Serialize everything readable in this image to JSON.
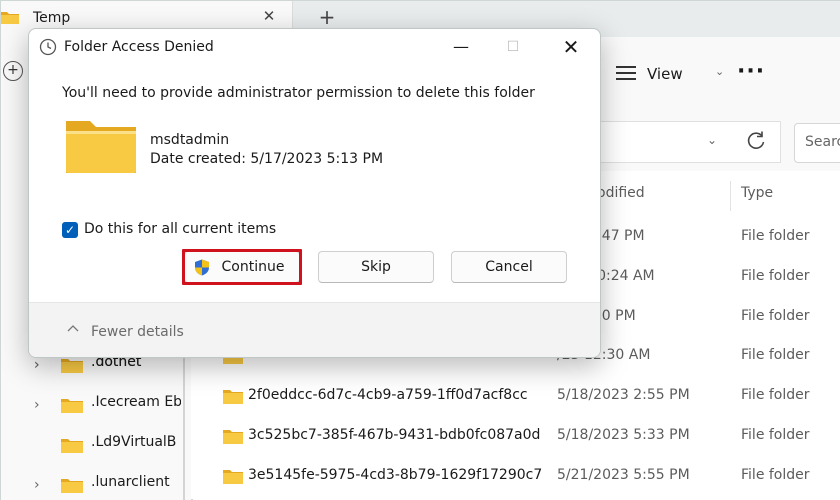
{
  "tab": {
    "title": "Temp",
    "close_glyph": "✕",
    "new_tab_glyph": "+"
  },
  "toolbar": {
    "new_glyph": "+",
    "view_label": "View",
    "view_chevron": "⌄",
    "more_glyph": "···"
  },
  "address": {
    "chevron": "⌄",
    "search_placeholder": "Searc"
  },
  "columns": {
    "modified": "odified",
    "type": "Type"
  },
  "nav": {
    "expand_glyph": "›",
    "collapse_glyph": "⌄",
    "items": [
      {
        "label": ".dotnet"
      },
      {
        "label": ".Icecream Eb"
      },
      {
        "label": ".Ld9VirtualB"
      },
      {
        "label": ".lunarclient"
      }
    ]
  },
  "files": [
    {
      "name": "",
      "date": "23 12:47 PM",
      "type": "File folder"
    },
    {
      "name": "",
      "date": "023 10:24 AM",
      "type": "File folder"
    },
    {
      "name": "",
      "date": "23 2:50 PM",
      "type": "File folder"
    },
    {
      "name": "",
      "date": "/23 12:30 AM",
      "type": "File folder"
    },
    {
      "name": "2f0eddcc-6d7c-4cb9-a759-1ff0d7acf8cc",
      "date": "5/18/2023 2:55 PM",
      "type": "File folder"
    },
    {
      "name": "3c525bc7-385f-467b-9431-bdb0fc087a0d",
      "date": "5/18/2023 5:33 PM",
      "type": "File folder"
    },
    {
      "name": "3e5145fe-5975-4cd3-8b79-1629f17290c7",
      "date": "5/21/2023 5:55 PM",
      "type": "File folder"
    }
  ],
  "dialog": {
    "title": "Folder Access Denied",
    "minimize_glyph": "—",
    "maximize_glyph": "☐",
    "close_glyph": "✕",
    "message": "You'll need to provide administrator permission to delete this folder",
    "item_name": "msdtadmin",
    "item_date": "Date created: 5/17/2023 5:13 PM",
    "checkbox_checked": true,
    "checkbox_glyph": "✓",
    "checkbox_label": "Do this for all current items",
    "continue_label": "Continue",
    "skip_label": "Skip",
    "cancel_label": "Cancel",
    "fewer_details_label": "Fewer details"
  },
  "colors": {
    "accent": "#005fb8",
    "highlight": "#d0111e",
    "folder": "#f8c943",
    "folder_dark": "#e5a921"
  },
  "icons": {
    "dialog": "clock-icon",
    "continue": "uac-shield-icon",
    "view": "list-view-icon",
    "refresh": "refresh-icon",
    "folder": "folder-icon"
  }
}
